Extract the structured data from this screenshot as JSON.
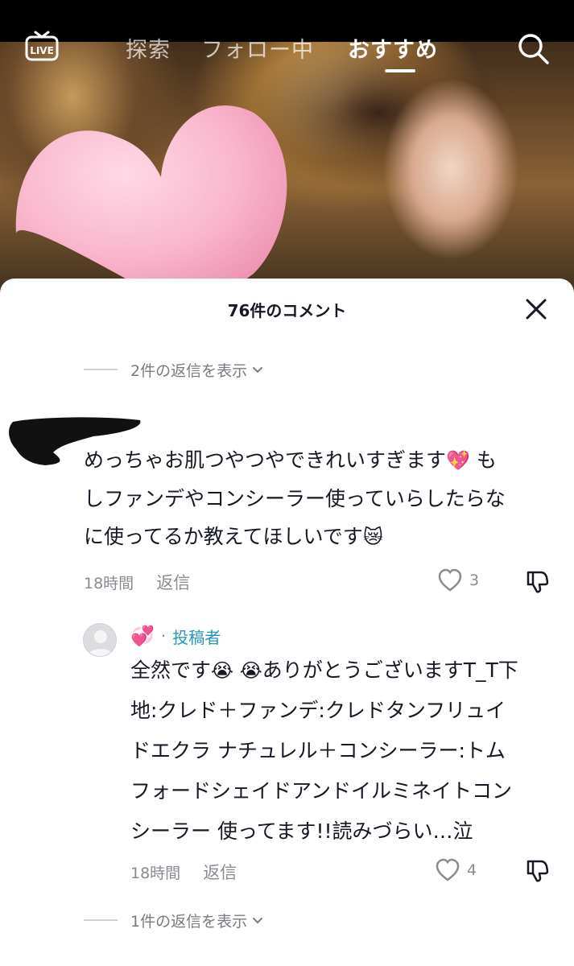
{
  "nav": {
    "live_label": "LIVE",
    "tabs": [
      {
        "label": "探索"
      },
      {
        "label": "フォロー中"
      },
      {
        "label": "おすすめ"
      }
    ]
  },
  "comments_sheet": {
    "title": "76件のコメント",
    "top_replies_toggle": "2件の返信を表示",
    "comment": {
      "text_line1": "めっちゃお肌つやつやできれいすぎます",
      "emoji1": "💖",
      "text_line1b": " も",
      "text_line2": "しファンデやコンシーラー使っていらしたらな",
      "text_line3": "に使ってるか教えてほしいです",
      "emoji2": "😿",
      "time": "18時間",
      "reply_label": "返信",
      "likes": "3"
    },
    "reply": {
      "author_emoji": "💞",
      "author_badge": "投稿者",
      "separator": "·",
      "line1a": "全然です",
      "line1_emoji": "😭 😭",
      "line1b": "ありがとうございますT_T下",
      "line2": "地:クレド＋ファンデ:クレドタンフリュイ",
      "line3": "ドエクラ ナチュレル＋コンシーラー:トム",
      "line4": "フォードシェイドアンドイルミネイトコン",
      "line5": "シーラー 使ってます!!読みづらい…泣",
      "time": "18時間",
      "reply_label": "返信",
      "likes": "4"
    },
    "bottom_replies_toggle": "1件の返信を表示"
  }
}
